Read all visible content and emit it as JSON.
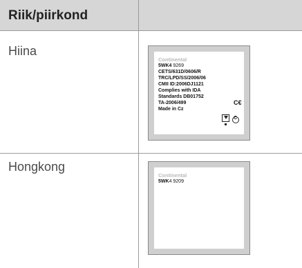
{
  "table": {
    "header": {
      "country_col": "Riik/piirkond",
      "label_col": ""
    },
    "rows": [
      {
        "country": "Hiina",
        "label": {
          "brand": "Continental",
          "lines": [
            {
              "bold": "5WK4",
              "rest": " 9269"
            },
            {
              "bold": "CETS/631D/0606/R",
              "rest": ""
            },
            {
              "bold": "TRC/LPD/SS/2006/06",
              "rest": ""
            },
            {
              "bold": "CMII ID:2006DJ1121",
              "rest": ""
            },
            {
              "bold": "Complies with IDA",
              "rest": ""
            },
            {
              "bold": "Standards DB01752",
              "rest": ""
            },
            {
              "bold": "TA-2006/499",
              "rest": ""
            },
            {
              "bold": "Made in Cz",
              "rest": ""
            }
          ],
          "ce_mark": "C€"
        }
      },
      {
        "country": "Hongkong",
        "label": {
          "brand": "Continental",
          "lines": [
            {
              "bold": "5WK",
              "rest": "4 9209"
            }
          ]
        }
      }
    ]
  }
}
